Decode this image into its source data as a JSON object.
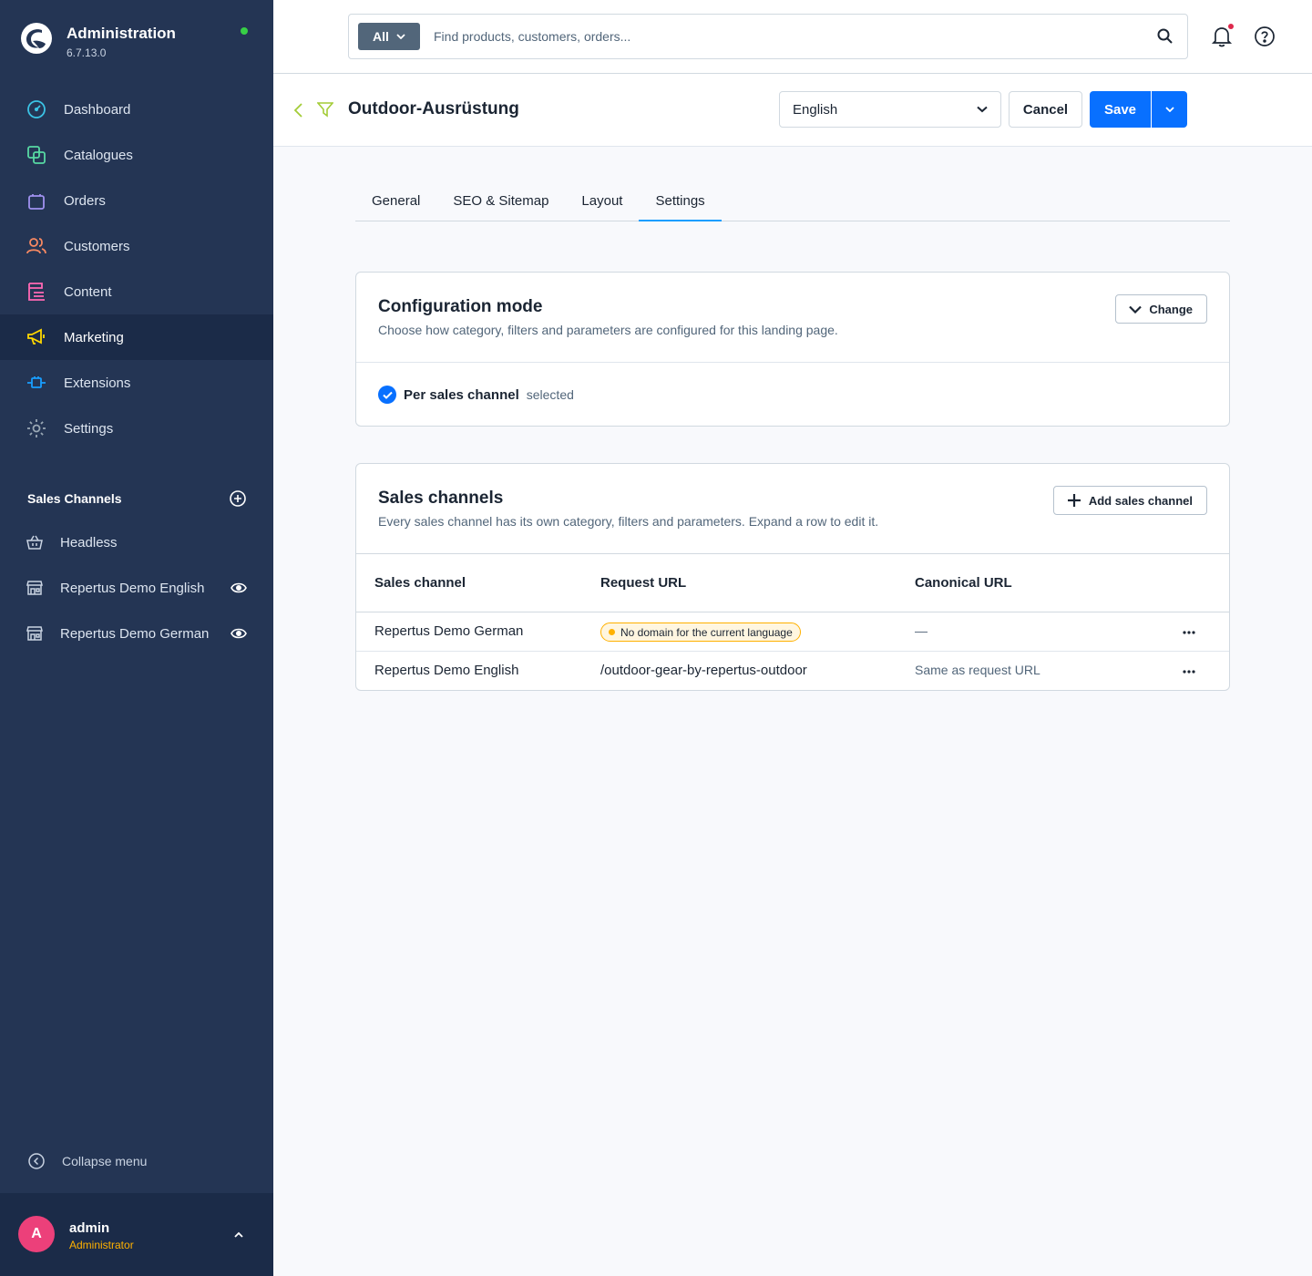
{
  "app": {
    "title": "Administration",
    "version": "6.7.13.0"
  },
  "nav": {
    "items": [
      {
        "label": "Dashboard",
        "icon": "gauge-icon",
        "color": "#3bc3e5"
      },
      {
        "label": "Catalogues",
        "icon": "catalogue-icon",
        "color": "#57d9a3"
      },
      {
        "label": "Orders",
        "icon": "shopping-bag-icon",
        "color": "#a092f0"
      },
      {
        "label": "Customers",
        "icon": "users-icon",
        "color": "#f88962"
      },
      {
        "label": "Content",
        "icon": "content-icon",
        "color": "#ff68b4"
      },
      {
        "label": "Marketing",
        "icon": "megaphone-icon",
        "color": "#ffd700"
      },
      {
        "label": "Extensions",
        "icon": "plug-icon",
        "color": "#189eff"
      },
      {
        "label": "Settings",
        "icon": "gear-icon",
        "color": "#9aa8b5"
      }
    ],
    "active": "Marketing"
  },
  "sales_channels_nav": {
    "heading": "Sales Channels",
    "items": [
      {
        "label": "Headless",
        "icon": "basket-icon",
        "visible_toggle": false
      },
      {
        "label": "Repertus Demo English",
        "icon": "storefront-icon",
        "visible_toggle": true
      },
      {
        "label": "Repertus Demo German",
        "icon": "storefront-icon",
        "visible_toggle": true
      }
    ]
  },
  "collapse_label": "Collapse menu",
  "user": {
    "initial": "A",
    "name": "admin",
    "role": "Administrator"
  },
  "search": {
    "type": "All",
    "placeholder": "Find products, customers, orders..."
  },
  "smartbar": {
    "title": "Outdoor-Ausrüstung",
    "language": "English",
    "cancel_label": "Cancel",
    "save_label": "Save"
  },
  "tabs": {
    "items": [
      "General",
      "SEO & Sitemap",
      "Layout",
      "Settings"
    ],
    "active": "Settings"
  },
  "config_card": {
    "title": "Configuration mode",
    "subtitle": "Choose how category, filters and parameters are configured for this landing page.",
    "change_label": "Change",
    "selected_name": "Per sales channel",
    "selected_state": "selected"
  },
  "channels_card": {
    "title": "Sales channels",
    "subtitle": "Every sales channel has its own category, filters and parameters. Expand a row to edit it.",
    "add_label": "Add sales channel",
    "columns": [
      "Sales channel",
      "Request URL",
      "Canonical URL"
    ],
    "rows": [
      {
        "channel": "Repertus Demo German",
        "request_url": "",
        "warning": "No domain for the current language",
        "canonical": "—"
      },
      {
        "channel": "Repertus Demo English",
        "request_url": "/outdoor-gear-by-repertus-outdoor",
        "warning": "",
        "canonical": "Same as request URL"
      }
    ]
  },
  "colors": {
    "sidebar": "#243554",
    "accent": "#0870ff",
    "tab_active": "#189eff",
    "warning": "#ffb100"
  }
}
